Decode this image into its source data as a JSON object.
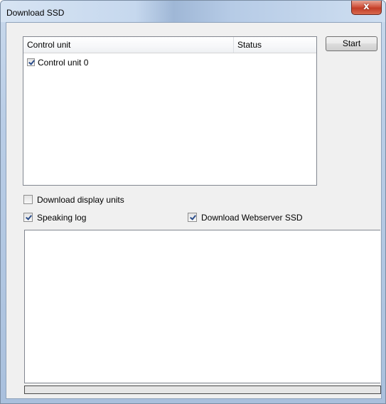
{
  "window": {
    "title": "Download SSD",
    "close_symbol": "x",
    "close_icon": "close-icon"
  },
  "control_unit_list": {
    "columns": [
      "Control unit",
      "Status"
    ],
    "rows": [
      {
        "label": "Control unit 0",
        "checked": true,
        "status": ""
      }
    ]
  },
  "start_button": {
    "label": "Start"
  },
  "options": {
    "download_display_units": {
      "label": "Download display units",
      "checked": false
    },
    "speaking_log": {
      "label": "Speaking log",
      "checked": true
    },
    "download_webserver_ssd": {
      "label": "Download Webserver SSD",
      "checked": true
    }
  },
  "log": {
    "text": ""
  },
  "progress": {
    "value": 0
  },
  "colors": {
    "progress_fill": "#06b025",
    "close_button": "#c23d26"
  }
}
